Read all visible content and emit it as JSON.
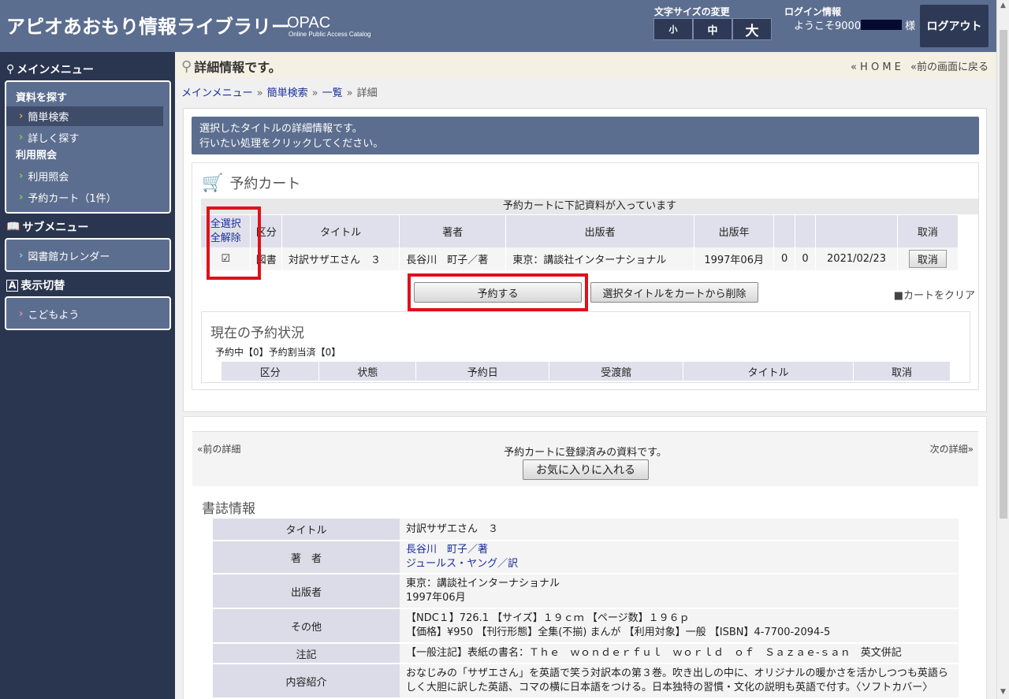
{
  "header": {
    "logo": "アピオあおもり情報ライブラリー",
    "opac": "OPAC",
    "opac_sub": "Online Public Access Catalog",
    "font_size_label": "文字サイズの変更",
    "font_sizes": [
      "小",
      "中",
      "大"
    ],
    "login_label": "ログイン情報",
    "welcome": "ようこそ9000",
    "honorific": "様",
    "logout": "ログアウト"
  },
  "sidebar": {
    "main_menu": "メインメニュー",
    "cat_search": "資料を探す",
    "simple_search": "簡単検索",
    "detail_search": "詳しく探す",
    "cat_usage": "利用照会",
    "usage_inquiry": "利用照会",
    "reserve_cart": "予約カート（1件）",
    "sub_menu": "サブメニュー",
    "calendar": "図書館カレンダー",
    "display_switch": "表示切替",
    "kids": "こどもよう"
  },
  "main": {
    "page_title": "詳細情報です。",
    "home": "« H O M E",
    "back": "«前の画面に戻る",
    "breadcrumb": [
      "メインメニュー",
      "簡単検索",
      "一覧",
      "詳細"
    ],
    "notice_line1": "選択したタイトルの詳細情報です。",
    "notice_line2": "行いたい処理をクリックしてください。"
  },
  "cart": {
    "title": "予約カート",
    "message": "予約カートに下記資料が入っています",
    "select_all": "全選択",
    "deselect_all": "全解除",
    "headers": [
      "区分",
      "タイトル",
      "著者",
      "出版者",
      "出版年",
      "",
      "",
      "",
      "取消"
    ],
    "row": {
      "checkbox": "☑",
      "category": "図書",
      "title": "対訳サザエさん　３",
      "author": "長谷川　町子／著",
      "publisher": "東京：講談社インターナショナル",
      "year": "1997年06月",
      "n1": "0",
      "n2": "0",
      "date": "2021/02/23",
      "cancel": "取消"
    },
    "reserve_button": "予約する",
    "remove_button": "選択タイトルをカートから削除",
    "clear_cart": "■カートをクリア"
  },
  "status": {
    "title": "現在の予約状況",
    "counts": "予約中【0】予約割当済【0】",
    "headers": [
      "区分",
      "状態",
      "予約日",
      "受渡館",
      "タイトル",
      "取消"
    ]
  },
  "detail": {
    "prev": "«前の詳細",
    "next": "次の詳細»",
    "registered_msg": "予約カートに登録済みの資料です。",
    "favorite_button": "お気に入りに入れる",
    "biblio_title": "書誌情報",
    "rows": {
      "title_label": "タイトル",
      "title_value": "対訳サザエさん　３",
      "author_label": "著　者",
      "author_value1": "長谷川　町子／著",
      "author_value2": "ジュールス・ヤング／訳",
      "publisher_label": "出版者",
      "publisher_value1": "東京：講談社インターナショナル",
      "publisher_value2": "1997年06月",
      "other_label": "その他",
      "other_value1": "【NDC１】726.1 【サイズ】１９ｃｍ 【ページ数】１９６ｐ",
      "other_value2": "【価格】¥950 【刊行形態】全集(不揃) まんが 【利用対象】一般 【ISBN】4-7700-2094-5",
      "note_label": "注記",
      "note_value": "【一般注記】表紙の書名：Ｔｈｅ　ｗｏｎｄｅｒｆｕｌ　ｗｏｒｌｄ　ｏｆ　Ｓａｚａｅ-ｓａｎ　英文併記",
      "content_label": "内容紹介",
      "content_value": "おなじみの「サザエさん」を英語で笑う対訳本の第３巻。吹き出しの中に、オリジナルの暖かさを活かしつつも英語らしく大胆に訳した英語、コマの横に日本語をつける。日本独特の習慣・文化の説明も英語で付す。〈ソフトカバー〉"
    }
  }
}
